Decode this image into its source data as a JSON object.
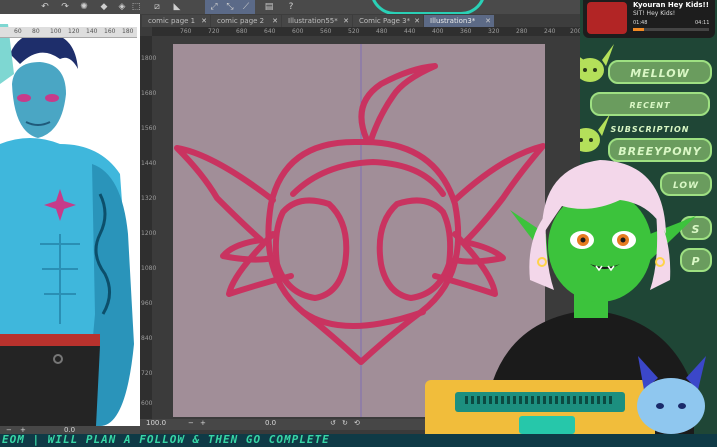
{
  "toolbar": {
    "icons": [
      "undo-icon",
      "redo-icon",
      "loading-icon",
      "fill-icon",
      "eraser-icon",
      "select-icon",
      "transform-icon",
      "lasso-icon",
      "document-icon",
      "help-icon"
    ]
  },
  "tabs": [
    {
      "label": "comic page 1",
      "active": false
    },
    {
      "label": "comic page 2",
      "active": false
    },
    {
      "label": "Illustration55*",
      "active": false
    },
    {
      "label": "Comic Page 3*",
      "active": false
    },
    {
      "label": "Illustration3*",
      "active": true
    }
  ],
  "rulers": {
    "top": [
      "760",
      "720",
      "680",
      "640",
      "600",
      "560",
      "520",
      "480",
      "440",
      "400",
      "360",
      "320",
      "280",
      "240",
      "200"
    ],
    "left_top": [
      "60",
      "80",
      "100",
      "120",
      "140",
      "160",
      "180"
    ],
    "side": [
      "1800",
      "1680",
      "1560",
      "1440",
      "1320",
      "1200",
      "1080",
      "960",
      "840",
      "720",
      "600"
    ]
  },
  "status": {
    "left_zoom": "0.0",
    "right_zoom": "100.0",
    "right_angle": "0.0"
  },
  "notification": {
    "name": "Kyouran Hey Kids!!",
    "message": "SIT! Hey Kids!",
    "time_start": "01:48",
    "time_end": "04:11",
    "progress": 0.15
  },
  "panel": {
    "labels": [
      "MELLOW",
      "RECENT SUBSCRIPTION",
      "BREEYPONY",
      "LOW",
      "S",
      "P"
    ],
    "colors": {
      "accent": "#9ee082",
      "stroke": "#c93360",
      "page": "#a18e98"
    }
  },
  "ticker": {
    "text": "EOM | WILL PLAN A FOLLOW & THEN GO COMPLETE"
  }
}
